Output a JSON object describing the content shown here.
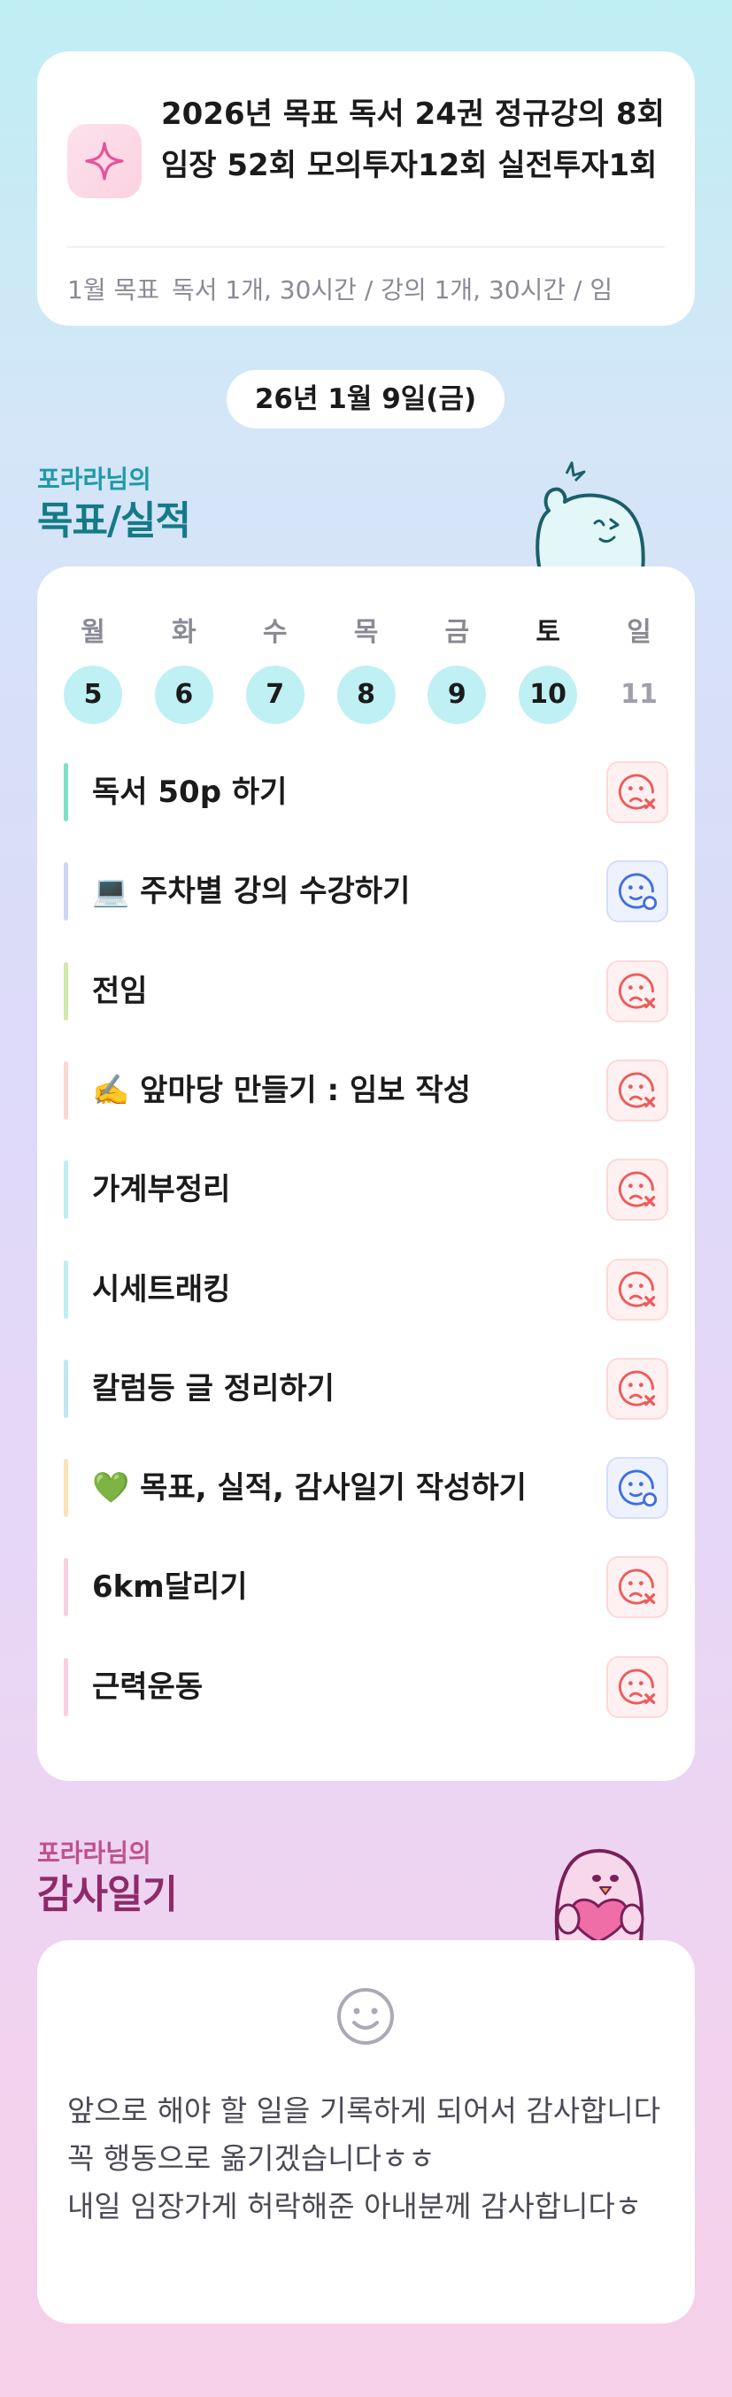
{
  "goal": {
    "title": "2026년 목표 독서 24권 정규강의 8회 임장 52회 모의투자12회 실전투자1회",
    "month_label": "1월 목표",
    "month_text": "독서 1개, 30시간 / 강의 1개, 30시간 / 임",
    "icon": "sparkle-icon"
  },
  "date": "26년 1월 9일(금)",
  "performance": {
    "subtitle": "포라라님의",
    "title": "목표/실적",
    "week": [
      {
        "wd": "월",
        "num": "5"
      },
      {
        "wd": "화",
        "num": "6"
      },
      {
        "wd": "수",
        "num": "7"
      },
      {
        "wd": "목",
        "num": "8"
      },
      {
        "wd": "금",
        "num": "9"
      },
      {
        "wd": "토",
        "num": "10"
      },
      {
        "wd": "일",
        "num": "11"
      }
    ],
    "tasks": [
      {
        "label": "독서 50p 하기",
        "status": "fail",
        "color": "#7fe0c8"
      },
      {
        "label": "💻 주차별 강의 수강하기",
        "status": "done",
        "color": "#cfd6f6"
      },
      {
        "label": "전임",
        "status": "fail",
        "color": "#cfeaa6"
      },
      {
        "label": "✍️ 앞마당 만들기 : 임보 작성",
        "status": "fail",
        "color": "#fbd6d2"
      },
      {
        "label": "가계부정리",
        "status": "fail",
        "color": "#bfeef3"
      },
      {
        "label": "시세트래킹",
        "status": "fail",
        "color": "#bfeef3"
      },
      {
        "label": "칼럼등 글 정리하기",
        "status": "fail",
        "color": "#bfe6f3"
      },
      {
        "label": "💚 목표, 실적, 감사일기 작성하기",
        "status": "done",
        "color": "#fbe3b8"
      },
      {
        "label": "6km달리기",
        "status": "fail",
        "color": "#f8cfe0"
      },
      {
        "label": "근력운동",
        "status": "fail",
        "color": "#f8cfe0"
      }
    ]
  },
  "diary": {
    "subtitle": "포라라님의",
    "title": "감사일기",
    "text": "앞으로 해야 할 일을 기록하게 되어서 감사합니다 꼭 행동으로 옮기겠습니다ㅎㅎ\n내일 임장가게 허락해준 아내분께 감사합니다ㅎ"
  },
  "colors": {
    "fail": "#ef5a5a",
    "done": "#3f6fe0",
    "accent_teal": "#137b87",
    "accent_pink": "#8f2a6a"
  }
}
